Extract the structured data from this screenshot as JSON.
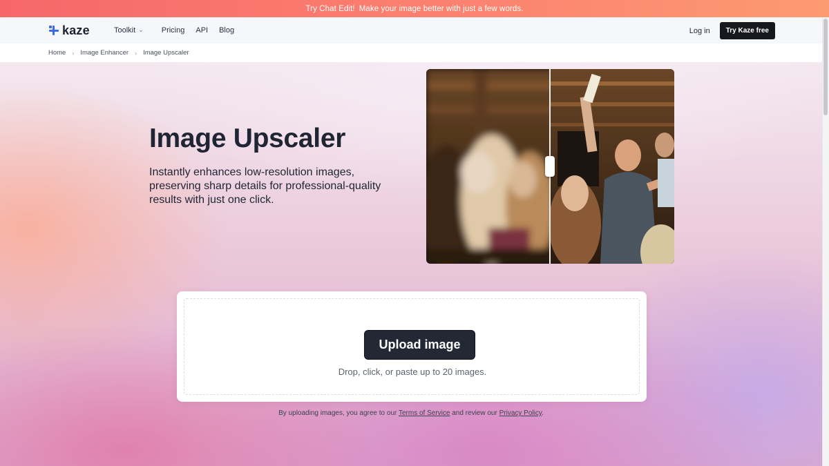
{
  "promo": {
    "link": "Try Chat Edit!",
    "text": "Make your image better with just a few words."
  },
  "header": {
    "logo_text": "kaze",
    "nav": [
      {
        "label": "Toolkit",
        "has_dropdown": true
      },
      {
        "label": "Pricing"
      },
      {
        "label": "API"
      },
      {
        "label": "Blog"
      }
    ],
    "login_label": "Log in",
    "cta_label": "Try Kaze free"
  },
  "breadcrumb": [
    "Home",
    "Image Enhancer",
    "Image Upscaler"
  ],
  "hero": {
    "title": "Image Upscaler",
    "subtitle": "Instantly enhances low-resolution images, preserving sharp details for professional-quality results with just one click."
  },
  "upload": {
    "button_label": "Upload image",
    "hint": "Drop, click, or paste up to 20 images."
  },
  "terms": {
    "prefix": "By uploading images, you agree to our",
    "tos": "Terms of Service",
    "middle": "and review our",
    "privacy": "Privacy Policy",
    "suffix": "."
  },
  "colors": {
    "promo_start": "#f6676a",
    "promo_end": "#fc9a72",
    "brand_blue": "#3b6be8",
    "button_dark": "#222834"
  }
}
